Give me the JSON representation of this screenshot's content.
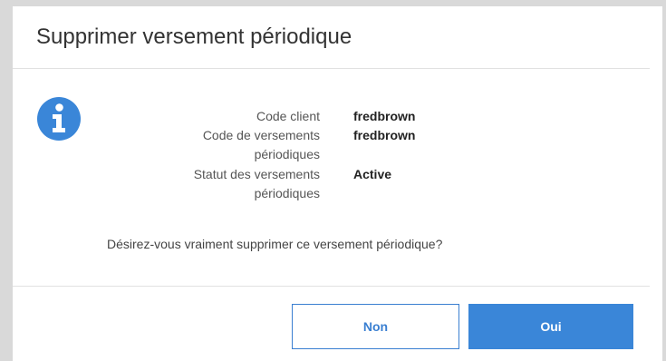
{
  "dialog": {
    "title": "Supprimer versement périodique",
    "fields": [
      {
        "label": "Code client",
        "value": "fredbrown"
      },
      {
        "label": "Code de versements périodiques",
        "value": "fredbrown"
      },
      {
        "label": "Statut des versements périodiques",
        "value": "Active"
      }
    ],
    "question": "Désirez-vous vraiment supprimer ce versement périodique?",
    "buttons": {
      "no_label": "Non",
      "yes_label": "Oui"
    },
    "icon": "info-icon"
  },
  "colors": {
    "accent": "#3a86d8",
    "icon": "#3a86d8",
    "backdrop": "#d9d9d9"
  }
}
